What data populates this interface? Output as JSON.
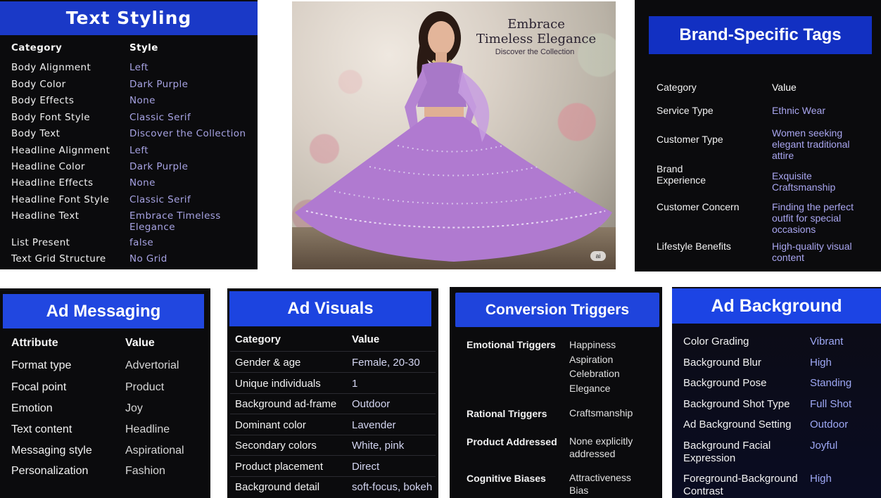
{
  "text_styling": {
    "title": "Text Styling",
    "col_category": "Category",
    "col_style": "Style",
    "rows": [
      {
        "k": "Body Alignment",
        "v": "Left"
      },
      {
        "k": "Body Color",
        "v": "Dark Purple"
      },
      {
        "k": "Body Effects",
        "v": "None"
      },
      {
        "k": "Body Font Style",
        "v": "Classic Serif"
      },
      {
        "k": "Body Text",
        "v": "Discover the Collection"
      },
      {
        "k": "Headline Alignment",
        "v": "Left"
      },
      {
        "k": "Headline Color",
        "v": "Dark Purple"
      },
      {
        "k": "Headline Effects",
        "v": "None"
      },
      {
        "k": "Headline Font Style",
        "v": "Classic Serif"
      },
      {
        "k": "Headline Text",
        "v": "Embrace Timeless\nElegance"
      },
      {
        "k": "List Present",
        "v": "false"
      },
      {
        "k": "Text Grid Structure",
        "v": "No Grid"
      }
    ]
  },
  "ad_image": {
    "headline": "Embrace\nTimeless Elegance",
    "subtext": "Discover the Collection",
    "badge": "ai"
  },
  "brand_tags": {
    "title": "Brand-Specific Tags",
    "col_category": "Category",
    "col_value": "Value",
    "rows": [
      {
        "k": "Service Type",
        "v": "Ethnic Wear"
      },
      {
        "k": "Customer Type",
        "v": "Women seeking\nelegant traditional\nattire"
      },
      {
        "k": "Brand\nExperience",
        "v": "Exquisite\nCraftsmanship"
      },
      {
        "k": "Customer Concern",
        "v": "Finding the perfect\noutfit for special\noccasions"
      },
      {
        "k": "Lifestyle Benefits",
        "v": "High-quality visual\ncontent"
      }
    ]
  },
  "ad_messaging": {
    "title": "Ad Messaging",
    "col_attribute": "Attribute",
    "col_value": "Value",
    "rows": [
      {
        "k": "Format type",
        "v": "Advertorial"
      },
      {
        "k": "Focal point",
        "v": "Product"
      },
      {
        "k": "Emotion",
        "v": "Joy"
      },
      {
        "k": "Text content",
        "v": "Headline"
      },
      {
        "k": "Messaging style",
        "v": "Aspirational"
      },
      {
        "k": "Personalization",
        "v": "Fashion"
      }
    ]
  },
  "ad_visuals": {
    "title": "Ad Visuals",
    "col_category": "Category",
    "col_value": "Value",
    "rows": [
      {
        "k": "Gender & age",
        "v": "Female, 20-30"
      },
      {
        "k": "Unique individuals",
        "v": "1"
      },
      {
        "k": "Background ad-frame",
        "v": "Outdoor"
      },
      {
        "k": "Dominant color",
        "v": "Lavender"
      },
      {
        "k": "Secondary colors",
        "v": "White, pink"
      },
      {
        "k": "Product placement",
        "v": "Direct"
      },
      {
        "k": "Background detail",
        "v": "soft-focus, bokeh"
      }
    ]
  },
  "conversion_triggers": {
    "title": "Conversion Triggers",
    "rows": [
      {
        "k": "Emotional Triggers",
        "v": "Happiness\nAspiration\nCelebration\nElegance"
      },
      {
        "k": "Rational Triggers",
        "v": "Craftsmanship"
      },
      {
        "k": "Product Addressed",
        "v": "None explicitly\naddressed"
      },
      {
        "k": "Cognitive Biases",
        "v": "Attractiveness\nBias"
      }
    ]
  },
  "ad_background": {
    "title": "Ad Background",
    "rows": [
      {
        "k": "Color Grading",
        "v": "Vibrant"
      },
      {
        "k": "Background Blur",
        "v": "High"
      },
      {
        "k": "Background Pose",
        "v": "Standing"
      },
      {
        "k": "Background Shot Type",
        "v": "Full Shot"
      },
      {
        "k": "Ad Background Setting",
        "v": "Outdoor"
      },
      {
        "k": "Background Facial\nExpression",
        "v": "Joyful"
      },
      {
        "k": "Foreground-Background\nContrast",
        "v": "High"
      }
    ]
  }
}
